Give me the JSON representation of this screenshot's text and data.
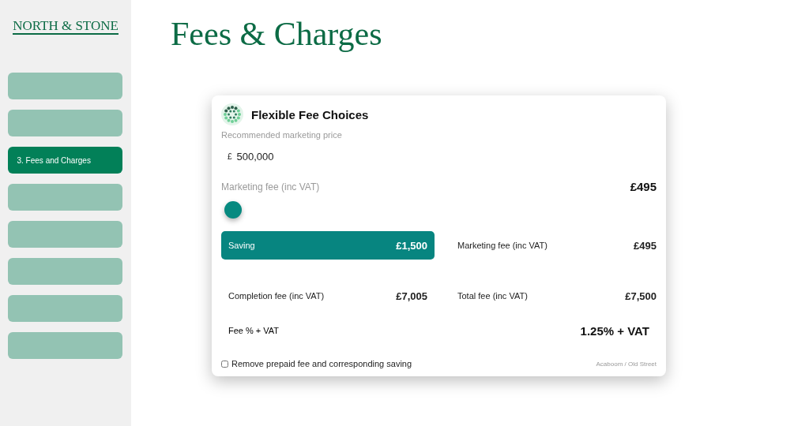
{
  "brand": "NORTH & STONE",
  "nav": [
    {
      "selected": false
    },
    {
      "selected": false
    },
    {
      "selected": true,
      "label": "3. Fees and Charges"
    },
    {
      "selected": false
    },
    {
      "selected": false
    },
    {
      "selected": false
    },
    {
      "selected": false
    },
    {
      "selected": false
    }
  ],
  "page_title": "Fees & Charges",
  "card": {
    "title": "Flexible Fee Choices",
    "price_label": "Recommended marketing price",
    "currency": "£",
    "price": "500,000",
    "fee_label": "Marketing fee (inc VAT)",
    "fee_value": "£495",
    "slider": {
      "level": 0
    },
    "summary": [
      {
        "label": "Saving",
        "value": "£1,500",
        "highlight": true
      },
      {
        "label": "Marketing fee (inc VAT)",
        "value": "£495",
        "highlight": false
      },
      {
        "label": "Completion fee (inc VAT)",
        "value": "£7,005",
        "highlight": false
      },
      {
        "label": "Total fee (inc VAT)",
        "value": "£7,500",
        "highlight": false
      }
    ],
    "fee_percent": {
      "label": "Fee % + VAT",
      "value": "1.25% + VAT"
    },
    "remove_prepaid": {
      "label": "Remove prepaid fee and corresponding saving",
      "checked": false
    },
    "credit": "Acaboom / Old Street"
  }
}
